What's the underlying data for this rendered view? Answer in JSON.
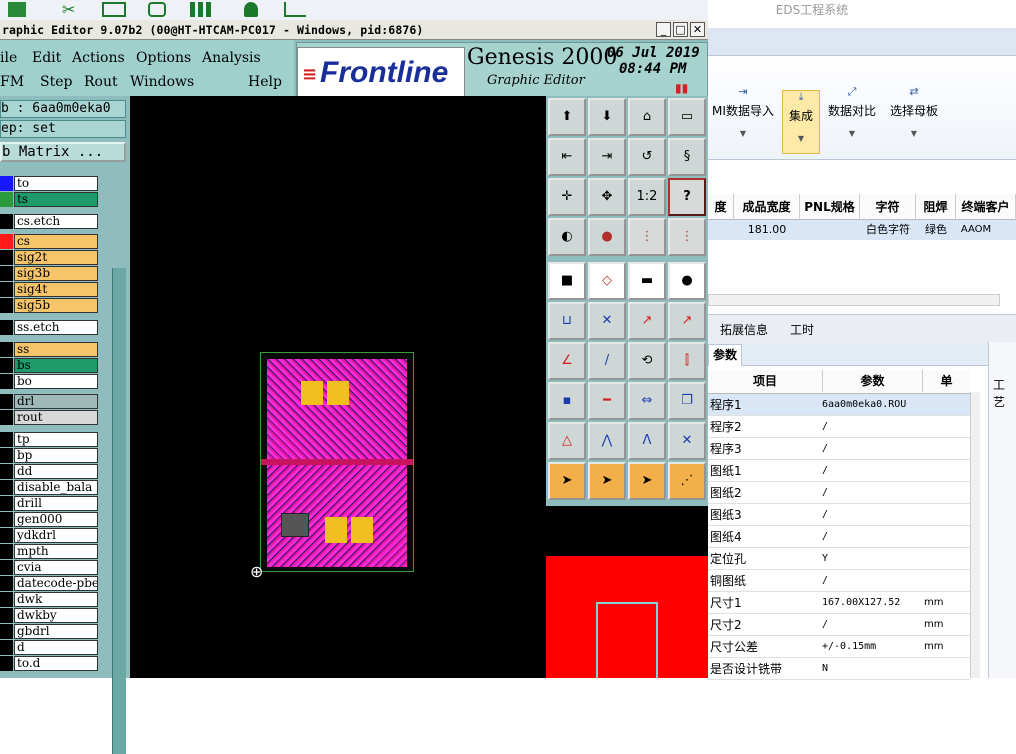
{
  "top_strip": {
    "right_title": "EDS工程系统"
  },
  "genesis": {
    "title": "raphic Editor 9.07b2 (00@HT-HTCAM-PC017 - Windows, pid:6876)",
    "menu_row1": [
      "ile",
      "Edit",
      "Actions",
      "Options",
      "Analysis"
    ],
    "menu_row2": [
      "FM",
      "Step",
      "Rout",
      "Windows",
      "Help"
    ],
    "brand": "Frontline",
    "product": "Genesis 2000",
    "product_sub": "Graphic Editor",
    "date": "06 Jul 2019",
    "time": "08:44 PM",
    "job_line": "b : 6aa0m0eka0",
    "step_line": "ep: set",
    "matrix_button": "b Matrix ...",
    "layers": [
      {
        "name": "to",
        "swatch": "#1818ff",
        "bg": "#ffffff"
      },
      {
        "name": "ts",
        "swatch": "#2a9a3a",
        "bg": "#1f9a6a"
      },
      {
        "name": "cs.etch",
        "swatch": "#000000",
        "bg": "#ffffff"
      },
      {
        "name": "cs",
        "swatch": "#ff1a1a",
        "bg": "#f6c56a"
      },
      {
        "name": "sig2t",
        "swatch": "#000000",
        "bg": "#f6c56a"
      },
      {
        "name": "sig3b",
        "swatch": "#000000",
        "bg": "#f6c56a"
      },
      {
        "name": "sig4t",
        "swatch": "#000000",
        "bg": "#f6c56a"
      },
      {
        "name": "sig5b",
        "swatch": "#000000",
        "bg": "#f6c56a"
      },
      {
        "name": "ss.etch",
        "swatch": "#000000",
        "bg": "#ffffff"
      },
      {
        "name": "ss",
        "swatch": "#000000",
        "bg": "#f6c56a"
      },
      {
        "name": "bs",
        "swatch": "#000000",
        "bg": "#1f9a6a"
      },
      {
        "name": "bo",
        "swatch": "#000000",
        "bg": "#ffffff"
      },
      {
        "name": "drl",
        "swatch": "#000000",
        "bg": "#9fb8b8"
      },
      {
        "name": "rout",
        "swatch": "#000000",
        "bg": "#d8d8d8"
      },
      {
        "name": "tp",
        "swatch": "#000000",
        "bg": "#ffffff"
      },
      {
        "name": "bp",
        "swatch": "#000000",
        "bg": "#ffffff"
      },
      {
        "name": "dd",
        "swatch": "#000000",
        "bg": "#ffffff"
      },
      {
        "name": "disable_bala",
        "swatch": "#000000",
        "bg": "#ffffff"
      },
      {
        "name": "drill",
        "swatch": "#000000",
        "bg": "#ffffff"
      },
      {
        "name": "gen000",
        "swatch": "#000000",
        "bg": "#ffffff"
      },
      {
        "name": "ydkdrl",
        "swatch": "#000000",
        "bg": "#ffffff"
      },
      {
        "name": "mpth",
        "swatch": "#000000",
        "bg": "#ffffff"
      },
      {
        "name": "cvia",
        "swatch": "#000000",
        "bg": "#ffffff"
      },
      {
        "name": "datecode-pbe",
        "swatch": "#000000",
        "bg": "#ffffff"
      },
      {
        "name": "dwk",
        "swatch": "#000000",
        "bg": "#ffffff"
      },
      {
        "name": "dwkby",
        "swatch": "#000000",
        "bg": "#ffffff"
      },
      {
        "name": "gbdrl",
        "swatch": "#000000",
        "bg": "#ffffff"
      },
      {
        "name": "d",
        "swatch": "#000000",
        "bg": "#ffffff"
      },
      {
        "name": "to.d",
        "swatch": "#000000",
        "bg": "#ffffff"
      }
    ],
    "tool_ratio_label": "1:2",
    "tool_help_label": "?"
  },
  "erp": {
    "ribbon_buttons": [
      "MI数据导入",
      "集成",
      "数据对比",
      "选择母板"
    ],
    "grid_headers": [
      "度",
      "成品宽度",
      "PNL规格",
      "字符",
      "阻焊",
      "终端客户"
    ],
    "grid_row": [
      "",
      "181.00",
      "",
      "白色字符",
      "绿色",
      "AAOM"
    ],
    "lower_tabs": [
      "拓展信息",
      "工时"
    ],
    "sub_tab": "参数",
    "right_tab": "工艺",
    "param_headers": [
      "项目",
      "参数",
      "单"
    ],
    "params": [
      {
        "item": "程序1",
        "value": "6aa0m0eka0.ROU",
        "unit": ""
      },
      {
        "item": "程序2",
        "value": "/",
        "unit": ""
      },
      {
        "item": "程序3",
        "value": "/",
        "unit": ""
      },
      {
        "item": "图纸1",
        "value": "/",
        "unit": ""
      },
      {
        "item": "图纸2",
        "value": "/",
        "unit": ""
      },
      {
        "item": "图纸3",
        "value": "/",
        "unit": ""
      },
      {
        "item": "图纸4",
        "value": "/",
        "unit": ""
      },
      {
        "item": "定位孔",
        "value": "Y",
        "unit": ""
      },
      {
        "item": "铜图纸",
        "value": "/",
        "unit": ""
      },
      {
        "item": "尺寸1",
        "value": "167.00X127.52",
        "unit": "mm"
      },
      {
        "item": "尺寸2",
        "value": "/",
        "unit": "mm"
      },
      {
        "item": "尺寸公差",
        "value": "+/-0.15mm",
        "unit": "mm"
      },
      {
        "item": "是否设计铣带",
        "value": "N",
        "unit": ""
      }
    ]
  }
}
